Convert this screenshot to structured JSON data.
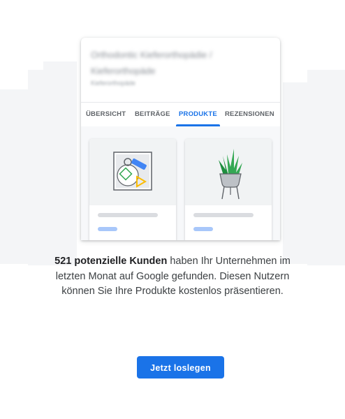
{
  "listing": {
    "business_name": "Orthodontic Kieferorthopädie / Kieferorthopäde",
    "category": "Kieferorthopäde",
    "tabs": [
      {
        "label": "ÜBERSICHT",
        "active": false
      },
      {
        "label": "BEITRÄGE",
        "active": false
      },
      {
        "label": "PRODUKTE",
        "active": true
      },
      {
        "label": "REZENSIONEN",
        "active": false
      }
    ],
    "products": [
      {
        "icon": "abstract-shapes-icon"
      },
      {
        "icon": "potted-plant-icon"
      }
    ]
  },
  "message": {
    "highlight": "521 potenzielle Kunden",
    "body": " haben Ihr Unternehmen im letzten Monat auf Google gefunden. Diesen Nutzern können Sie Ihre Produkte kostenlos präsentieren."
  },
  "cta": {
    "label": "Jetzt loslegen"
  },
  "colors": {
    "accent": "#1a73e8",
    "text": "#3c4043"
  }
}
